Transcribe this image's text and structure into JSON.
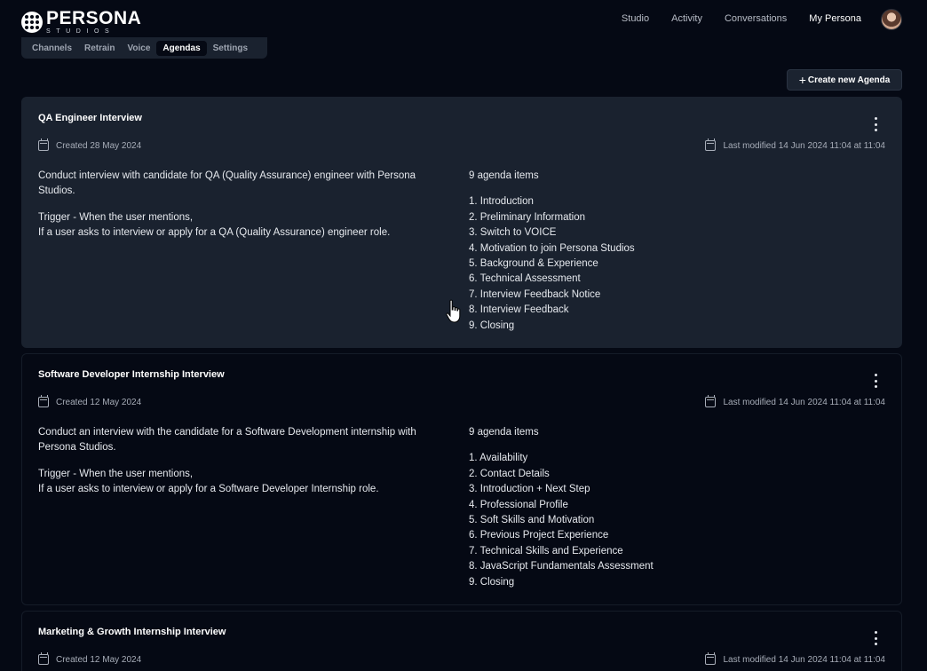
{
  "brand": {
    "name": "PERSONA",
    "sub": "STUDIOS"
  },
  "nav": {
    "items": [
      "Studio",
      "Activity",
      "Conversations",
      "My Persona"
    ],
    "active": "My Persona"
  },
  "tabs": [
    "Channels",
    "Retrain",
    "Voice",
    "Agendas",
    "Settings"
  ],
  "active_tab": "Agendas",
  "create_button": {
    "icon": "plus-icon",
    "label": "Create new Agenda"
  },
  "cards": [
    {
      "title": "QA Engineer Interview",
      "created": "Created 28 May 2024",
      "modified": "Last modified 14 Jun 2024 11:04 at 11:04",
      "description": "Conduct interview with candidate for QA (Quality Assurance) engineer with Persona Studios.",
      "trigger_line1": "Trigger - When the user mentions,",
      "trigger_line2": "If a user asks to interview or apply for a QA (Quality Assurance) engineer role.",
      "count": "9 agenda items",
      "items": [
        "1. Introduction",
        "2. Preliminary Information",
        "3. Switch to VOICE",
        "4. Motivation to join Persona Studios",
        "5. Background & Experience",
        "6. Technical Assessment",
        "7. Interview Feedback Notice",
        "8. Interview Feedback",
        "9. Closing"
      ]
    },
    {
      "title": "Software Developer Internship Interview",
      "created": "Created 12 May 2024",
      "modified": "Last modified 14 Jun 2024 11:04 at 11:04",
      "description": "Conduct an interview with the candidate for a Software Development internship with Persona Studios.",
      "trigger_line1": "Trigger - When the user mentions,",
      "trigger_line2": "If a user asks to interview or apply for a Software Developer Internship role.",
      "count": "9 agenda items",
      "items": [
        "1. Availability",
        "2. Contact Details",
        "3. Introduction + Next Step",
        "4. Professional Profile",
        "5. Soft Skills and Motivation",
        "6. Previous Project Experience",
        "7. Technical Skills and Experience",
        "8. JavaScript Fundamentals Assessment",
        "9. Closing"
      ]
    },
    {
      "title": "Marketing & Growth Internship Interview",
      "created": "Created 12 May 2024",
      "modified": "Last modified 14 Jun 2024 11:04 at 11:04"
    }
  ]
}
